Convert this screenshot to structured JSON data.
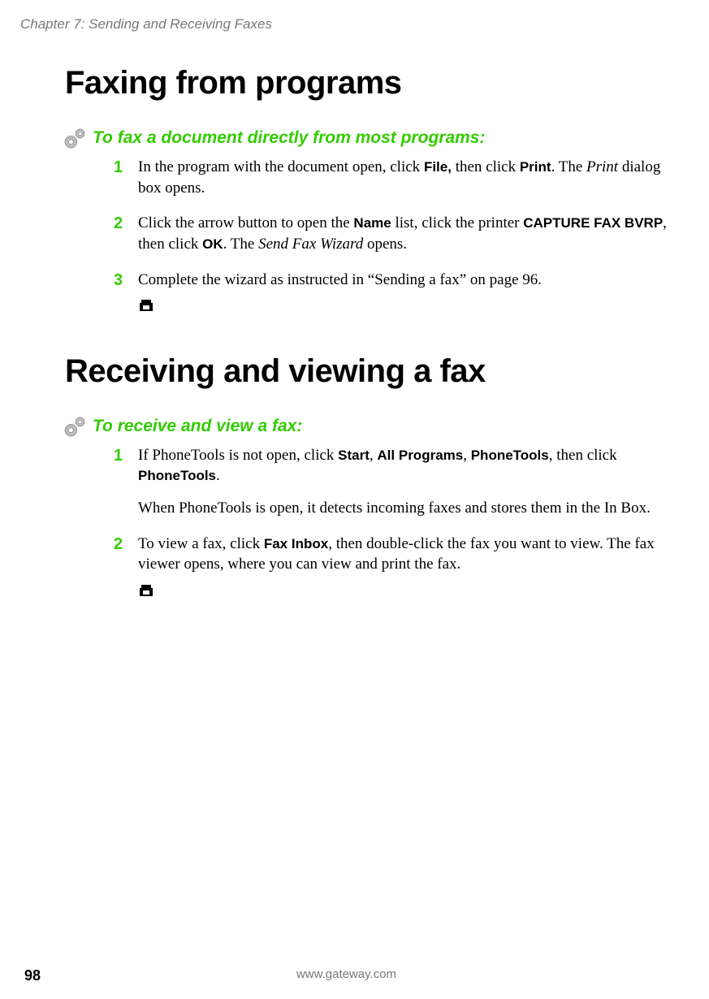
{
  "running_header": "Chapter 7: Sending and Receiving Faxes",
  "section1": {
    "title": "Faxing from programs",
    "task_title": "To fax a document directly from most programs:",
    "steps": [
      {
        "num": "1",
        "pre": "In the program with the document open, click ",
        "b1": "File,",
        "mid1": " then click ",
        "b2": "Print",
        "mid2": ". The ",
        "it1": "Print",
        "post": " dialog box opens."
      },
      {
        "num": "2",
        "pre": "Click the arrow button to open the ",
        "b1": "Name",
        "mid1": " list, click the printer ",
        "b2": "CAPTURE FAX BVRP",
        "mid2": ", then click ",
        "b3": "OK",
        "mid3": ". The ",
        "it1": "Send Fax Wizard",
        "post": " opens."
      },
      {
        "num": "3",
        "pre": "Complete the wizard as instructed in “Sending a fax” on page 96."
      }
    ]
  },
  "section2": {
    "title": "Receiving and viewing a fax",
    "task_title": "To receive and view a fax:",
    "steps": [
      {
        "num": "1",
        "pre": "If PhoneTools is not open, click ",
        "b1": "Start",
        "mid1": ", ",
        "b2": "All Programs",
        "mid2": ", ",
        "b3": "PhoneTools",
        "mid3": ", then click ",
        "b4": "PhoneTools",
        "post": ".",
        "after": "When PhoneTools is open, it detects incoming faxes and stores them in the In Box."
      },
      {
        "num": "2",
        "pre": "To view a fax, click ",
        "b1": "Fax Inbox",
        "post": ", then double-click the fax you want to view. The fax viewer opens, where you can view and print the fax."
      }
    ]
  },
  "footer": {
    "page_number": "98",
    "url": "www.gateway.com"
  }
}
